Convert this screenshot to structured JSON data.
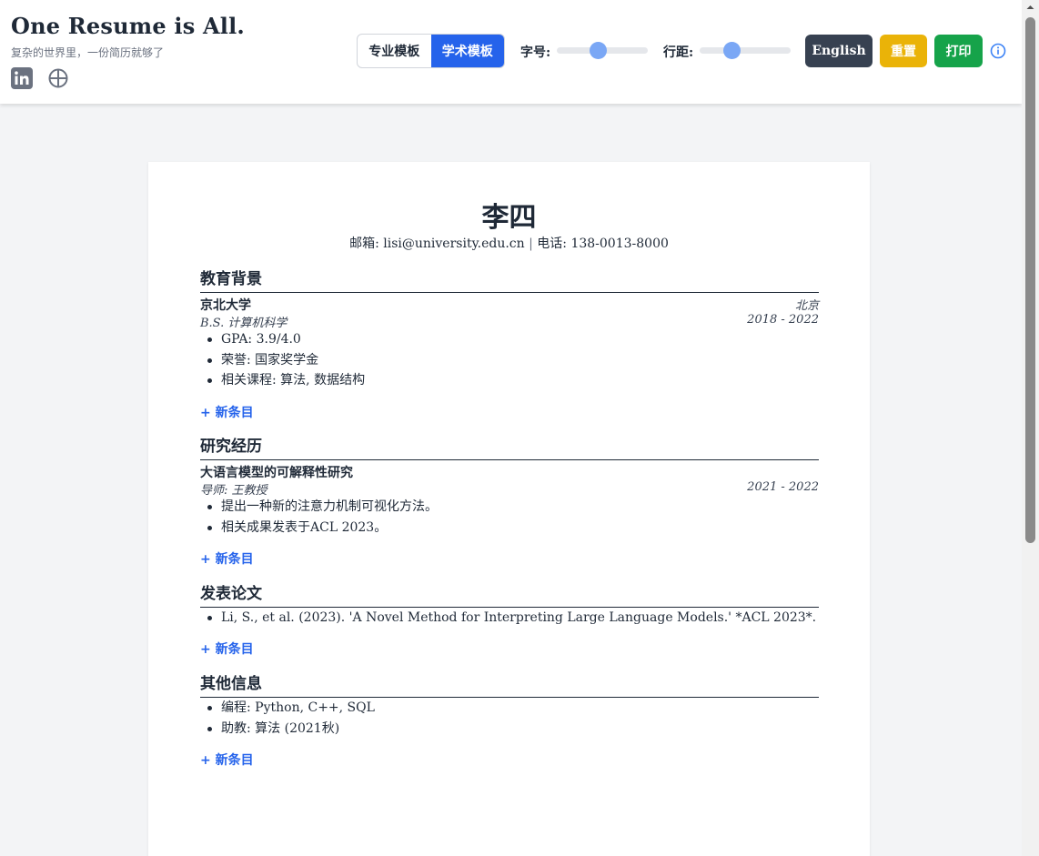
{
  "header": {
    "title": "One Resume is All.",
    "subtitle": "复杂的世界里，一份简历就够了",
    "templates": [
      "专业模板",
      "学术模板"
    ],
    "active_template": 1,
    "font_size_label": "字号:",
    "font_size_value": 0.45,
    "line_height_label": "行距:",
    "line_height_value": 0.35,
    "lang_button": "English",
    "reset_button": "重置",
    "print_button": "打印",
    "colors": {
      "accent": "#2563eb",
      "lang": "#374151",
      "reset": "#eab308",
      "print": "#16a34a"
    }
  },
  "resume": {
    "name": "李四",
    "contact": {
      "email_label": "邮箱:",
      "email": "lisi@university.edu.cn",
      "separator": "|",
      "phone_label": "电话:",
      "phone": "138-0013-8000"
    },
    "add_label": "+ 新条目",
    "education": {
      "title": "教育背景",
      "school": "京北大学",
      "location": "北京",
      "degree": "B.S. 计算机科学",
      "dates": "2018 - 2022",
      "bullets": [
        "GPA: 3.9/4.0",
        "荣誉: 国家奖学金",
        "相关课程: 算法, 数据结构"
      ]
    },
    "research": {
      "title": "研究经历",
      "project": "大语言模型的可解释性研究",
      "advisor": "导师: 王教授",
      "dates": "2021 - 2022",
      "bullets": [
        "提出一种新的注意力机制可视化方法。",
        "相关成果发表于ACL 2023。"
      ]
    },
    "publications": {
      "title": "发表论文",
      "bullets": [
        "Li, S., et al. (2023). 'A Novel Method for Interpreting Large Language Models.' *ACL 2023*."
      ]
    },
    "other": {
      "title": "其他信息",
      "bullets": [
        "编程: Python, C++, SQL",
        "助教: 算法 (2021秋)"
      ]
    }
  }
}
